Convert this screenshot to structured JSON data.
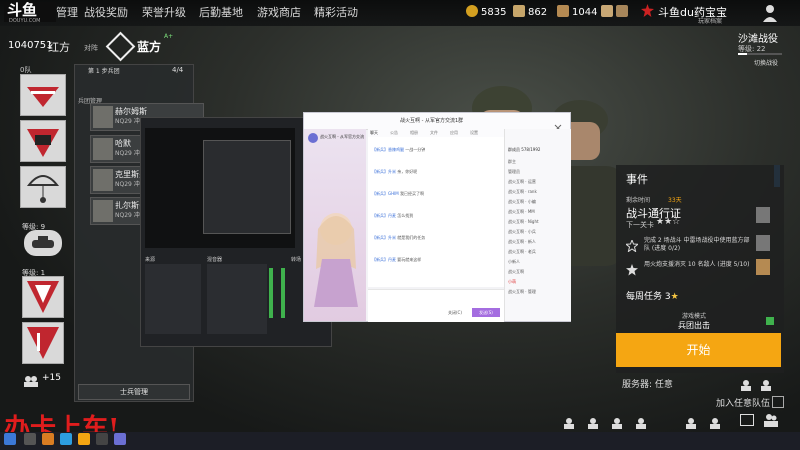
{
  "app": {
    "logo": "斗鱼",
    "logo_sub": "DOUYU.COM",
    "room_id": "1040751"
  },
  "nav": {
    "items": [
      "管理",
      "战役奖励",
      "荣誉升级",
      "后勤基地",
      "游戏商店",
      "精彩活动"
    ]
  },
  "resources": [
    {
      "value": "5835",
      "color": "#d4a020"
    },
    {
      "value": "862",
      "color": "#c7a66a"
    },
    {
      "value": "1044",
      "color": "#b58a52"
    }
  ],
  "player": {
    "name": "斗鱼du药宝宝",
    "tag": "玩家档案"
  },
  "teams": {
    "red": "红方",
    "vs": "对阵",
    "blue": "蓝方",
    "blue_badge": "A+"
  },
  "squad": {
    "label": "0队",
    "count": "4/4",
    "header": "第 1 步兵团",
    "sub": "兵团管理",
    "members": [
      {
        "name": "赫尔姆斯",
        "gun": "NQ29 冲锋"
      },
      {
        "name": "哈默",
        "gun": "NQ29 冲锋"
      },
      {
        "name": "克里斯多",
        "gun": "NQ29 冲锋"
      },
      {
        "name": "扎尔斯·阿",
        "gun": "NQ29 冲锋"
      }
    ],
    "manage": "士兵管理",
    "level_label": "等级: 9",
    "level_label2": "等级: 1",
    "plus_count": "+15"
  },
  "campaign": {
    "title": "沙滩战役",
    "level": "等级: 22",
    "switch": "切换战役"
  },
  "event": {
    "heading": "事件",
    "time_label": "剩余时间",
    "time_val": "33天",
    "pass": "战斗通行证",
    "pass_level": "下一关卡",
    "tasks": [
      {
        "text": "完成 2 场战斗 中雷场战役中使用蓝方部队 (进度 0/2)"
      },
      {
        "text": "用火炮支援消灭 10 名敌人 (进度 5/10)"
      }
    ],
    "weekly": "每周任务",
    "weekly_stars": "3",
    "mode_label": "游戏模式",
    "mode_val": "兵团出击",
    "start": "开始",
    "server": "服务器: 任意",
    "join": "加入任意队伍"
  },
  "chat": {
    "title": "战火互啊 - 从军官方交流1群",
    "group_left": "战火互啊 - 从军官方交流群",
    "member_count": "群成员 578/1992",
    "tabs": [
      "聊天",
      "公告",
      "相册",
      "文件",
      "应用",
      "设置"
    ],
    "send": "发送(S)",
    "close": "关闭(C)",
    "messages": [
      {
        "who": "【新兵】香辣鸡腿",
        "text": "一战一分钟"
      },
      {
        "who": "【新兵】升米",
        "text": "亲，你好呢"
      },
      {
        "who": "【新兵】GHIM",
        "text": "我已经买了啊"
      },
      {
        "who": "【新兵】丹麦",
        "text": "怎么找到"
      },
      {
        "who": "【新兵】升米",
        "text": "就是我们的任务"
      },
      {
        "who": "【新兵】丹麦",
        "text": "要玩就来这样"
      }
    ],
    "members": [
      "群主",
      "管理员",
      "战火互啊 · 运营",
      "战火互啊 · rank",
      "战火互啊 · 小编",
      "战火互啊 · MM",
      "战火互啊 · Night",
      "战火互啊 · 小兵",
      "战火互啊 · 新人",
      "战火互啊 · 老兵",
      "小新人",
      "战火互啊",
      "小萌",
      "战火互啊 · 管理"
    ]
  },
  "obs": {
    "panel1": "来源",
    "panel2": "混音器",
    "panel3": "转场"
  },
  "overlay": {
    "slogan": "办卡上车!"
  }
}
